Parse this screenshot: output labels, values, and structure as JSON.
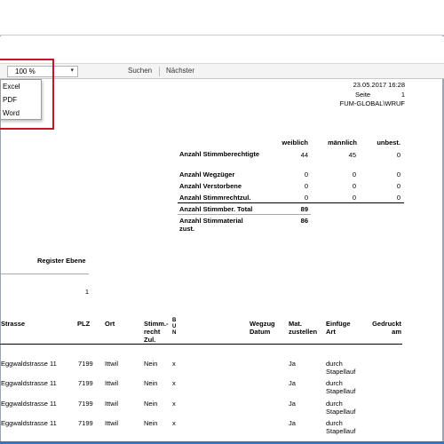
{
  "toolbar": {
    "zoom_value": "100 %",
    "search_label": "Suchen",
    "next_label": "Nächster"
  },
  "export_menu": {
    "items": [
      "Excel",
      "PDF",
      "Word"
    ]
  },
  "colors": {
    "highlight": "#c8142a",
    "window_frame": "#3f6fb7"
  },
  "icons": {
    "zoom_dropdown": "chevron-down-icon"
  },
  "report": {
    "date": "23.05.2017 16:28",
    "page_label": "Seite",
    "page_number": "1",
    "user": "FUM-GLOBAL\\WRUF",
    "stats": {
      "headers": [
        "weiblich",
        "männlich",
        "unbest."
      ],
      "rows": [
        {
          "label": "Anzahl Stimmberechtigte",
          "weiblich": "44",
          "maennlich": "45",
          "unbest": "0"
        },
        {
          "label": "Anzahl Wegzüger",
          "weiblich": "0",
          "maennlich": "0",
          "unbest": "0"
        },
        {
          "label": "Anzahl Verstorbene",
          "weiblich": "0",
          "maennlich": "0",
          "unbest": "0"
        },
        {
          "label": "Anzahl Stimmrechtzul.",
          "weiblich": "0",
          "maennlich": "0",
          "unbest": "0"
        },
        {
          "label": "Anzahl Stimmber. Total",
          "weiblich": "89"
        },
        {
          "label": "Anzahl Stimmaterial zust.",
          "weiblich": "86"
        }
      ]
    },
    "register_label": "Register Ebene",
    "register_value": "1",
    "table": {
      "headers": {
        "strasse": "Strasse",
        "plz": "PLZ",
        "ort": "Ort",
        "stimmrecht": "Stimm.-recht Zul.",
        "bun": "B U N",
        "wegzug": "Wegzug Datum",
        "mat": "Mat. zustellen",
        "einfuege": "Einfüge Art",
        "gedruckt": "Gedruckt am"
      },
      "rows": [
        {
          "strasse": "Eggwaldstrasse 11",
          "plz": "7199",
          "ort": "Ittwil",
          "stimmrecht": "Nein",
          "bun": "x",
          "mat": "Ja",
          "einfuege": "durch Stapellauf"
        },
        {
          "strasse": "Eggwaldstrasse 11",
          "plz": "7199",
          "ort": "Ittwil",
          "stimmrecht": "Nein",
          "bun": "x",
          "mat": "Ja",
          "einfuege": "durch Stapellauf"
        },
        {
          "strasse": "Eggwaldstrasse 11",
          "plz": "7199",
          "ort": "Ittwil",
          "stimmrecht": "Nein",
          "bun": "x",
          "mat": "Ja",
          "einfuege": "durch Stapellauf"
        },
        {
          "strasse": "Eggwaldstrasse 11",
          "plz": "7199",
          "ort": "Ittwil",
          "stimmrecht": "Nein",
          "bun": "x",
          "mat": "Ja",
          "einfuege": "durch Stapellauf"
        }
      ]
    }
  }
}
